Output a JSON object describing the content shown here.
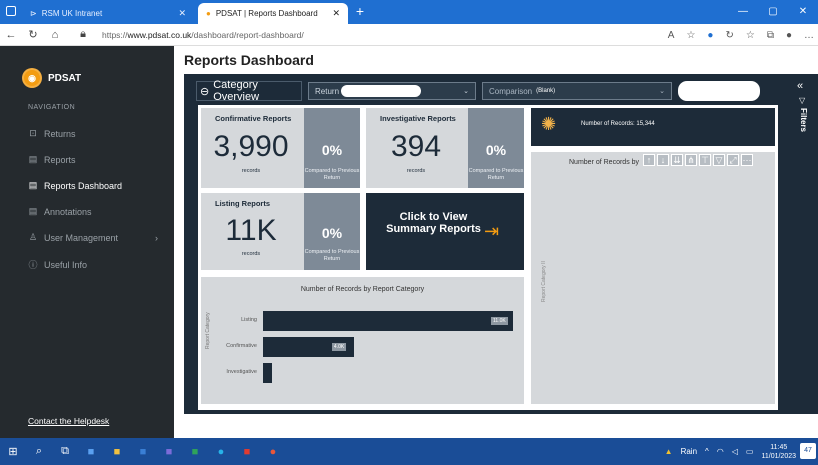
{
  "browser": {
    "tab1_title": "RSM UK Intranet",
    "tab2_title": "PDSAT | Reports Dashboard",
    "url_prefix": "https://",
    "url_host": "www.pdsat.co.uk",
    "url_path": "/dashboard/report-dashboard/"
  },
  "sidebar": {
    "brand": "PDSAT",
    "nav_header": "NAVIGATION",
    "items": [
      {
        "label": "Returns",
        "icon": "return-icon"
      },
      {
        "label": "Reports",
        "icon": "report-icon"
      },
      {
        "label": "Reports Dashboard",
        "icon": "dashboard-icon",
        "active": true
      },
      {
        "label": "Annotations",
        "icon": "annotation-icon"
      },
      {
        "label": "User Management",
        "icon": "user-icon",
        "chevron": "›"
      },
      {
        "label": "Useful Info",
        "icon": "info-icon"
      }
    ],
    "helpdesk": "Contact the Helpdesk"
  },
  "page": {
    "title": "Reports Dashboard"
  },
  "report": {
    "category_overview": "Category Overview",
    "dropdown1_label": "Return",
    "dropdown2_label": "Comparison",
    "dropdown2_value": "(Blank)",
    "cards": [
      {
        "title": "Confirmative Reports",
        "value": "3,990",
        "unit": "records",
        "pct": "0%",
        "compare": "Compared to Previous Return"
      },
      {
        "title": "Investigative Reports",
        "value": "394",
        "unit": "records",
        "pct": "0%",
        "compare": "Compared to Previous Return"
      },
      {
        "title": "Listing Reports",
        "value": "11K",
        "unit": "records",
        "pct": "0%",
        "compare": "Compared to Previous Return"
      }
    ],
    "click_card": "Click to View Summary Reports",
    "kpi": "Number of Records: 15,344",
    "right_panel_title": "Number of Records by",
    "right_panel_ylabel": "Report Category II",
    "filters_label": "Filters"
  },
  "chart_data": {
    "type": "bar",
    "title": "Number of Records by Report Category",
    "ylabel": "Report Category",
    "categories": [
      "Listing",
      "Confirmative",
      "Investigative"
    ],
    "values": [
      11000,
      4000,
      394
    ],
    "data_labels": [
      "11.0K",
      "4.0K",
      ""
    ],
    "orientation": "horizontal"
  },
  "taskbar": {
    "weather": "Rain",
    "time": "11:45",
    "date": "11/01/2023",
    "notifications": "47"
  },
  "colors": {
    "navy": "#1d2b39",
    "sidebar": "#252a2e",
    "card": "#d5d8db",
    "accent": "#f39c12"
  }
}
